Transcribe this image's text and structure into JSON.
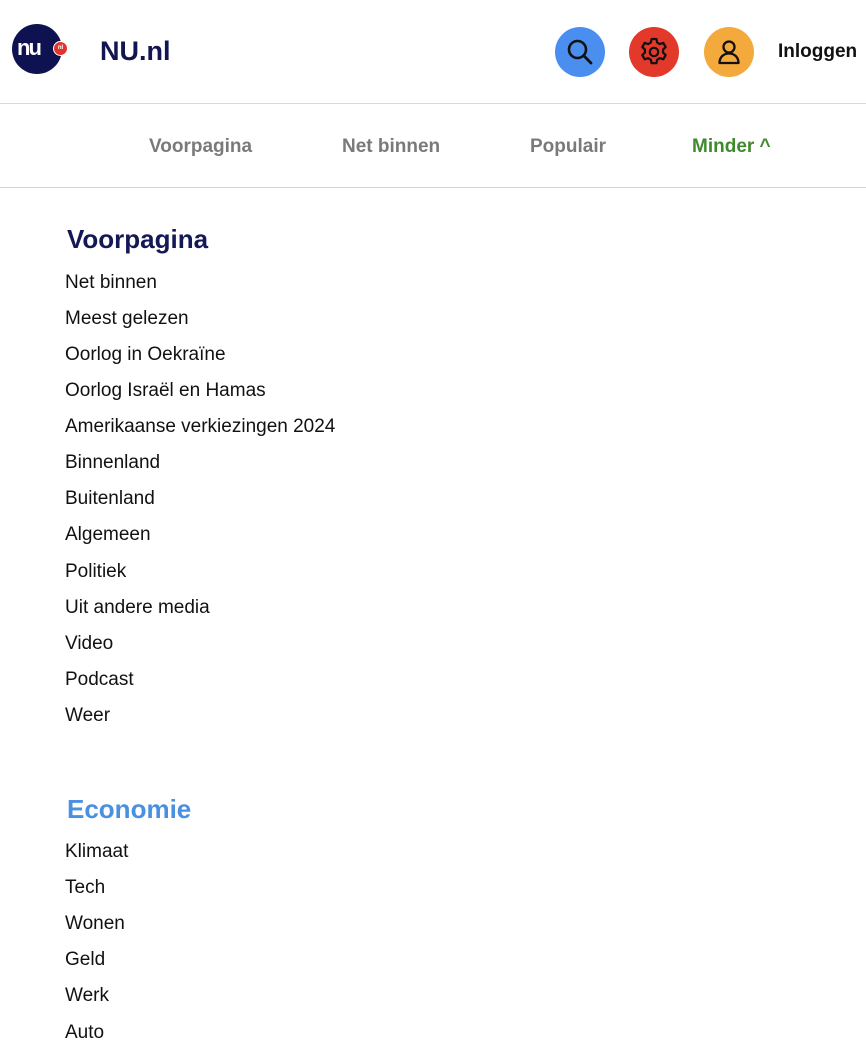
{
  "header": {
    "site_name": "NU.nl",
    "logo_text": "nu",
    "logo_badge": "nl",
    "login_label": "Inloggen",
    "icons": {
      "search": "search-icon",
      "settings": "gear-icon",
      "account": "user-icon"
    },
    "colors": {
      "search": "#4a8ff0",
      "settings": "#e2392b",
      "account": "#f3a93b",
      "brand": "#0f1250"
    }
  },
  "tabs": [
    {
      "label": "Voorpagina"
    },
    {
      "label": "Net binnen"
    },
    {
      "label": "Populair"
    },
    {
      "label": "Minder ^",
      "active": true
    }
  ],
  "sections": [
    {
      "title": "Voorpagina",
      "items": [
        "Net binnen",
        "Meest gelezen",
        "Oorlog in Oekraïne",
        "Oorlog Israël en Hamas",
        "Amerikaanse verkiezingen 2024",
        "Binnenland",
        "Buitenland",
        "Algemeen",
        "Politiek",
        "Uit andere media",
        "Video",
        "Podcast",
        "Weer"
      ]
    },
    {
      "title": "Economie",
      "items": [
        "Klimaat",
        "Tech",
        "Wonen",
        "Geld",
        "Werk",
        "Auto"
      ]
    }
  ]
}
